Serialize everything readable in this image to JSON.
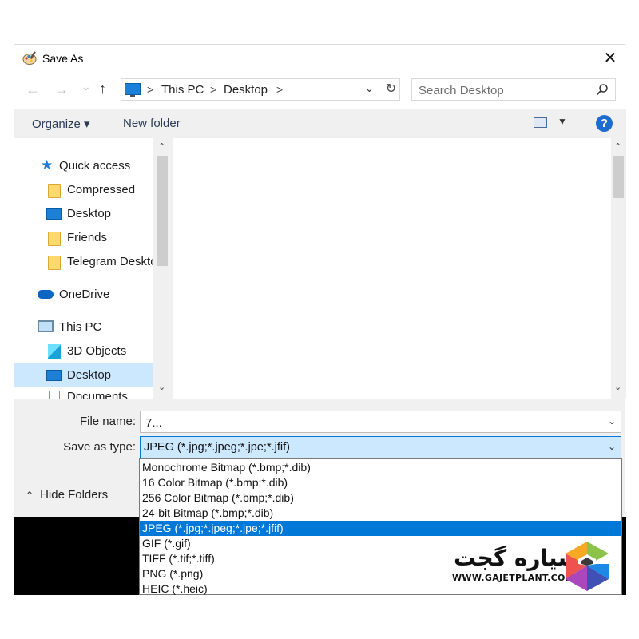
{
  "window": {
    "title": "Save As",
    "close_glyph": "✕"
  },
  "navbar": {
    "back_glyph": "←",
    "forward_glyph": "→",
    "recent_glyph": "⌄",
    "up_glyph": "↑",
    "breadcrumb": [
      "This PC",
      "Desktop"
    ],
    "separator": ">",
    "dropdown_glyph": "⌄",
    "refresh_glyph": "↻",
    "search_placeholder": "Search Desktop"
  },
  "toolbar": {
    "organize": "Organize ▾",
    "new_folder": "New folder",
    "view_dropdown": "▼",
    "help": "?"
  },
  "sidebar": {
    "items": [
      {
        "label": "Quick access",
        "icon": "star-icon"
      },
      {
        "label": "Compressed",
        "icon": "folder-icon"
      },
      {
        "label": "Desktop",
        "icon": "desktop-icon"
      },
      {
        "label": "Friends",
        "icon": "folder-icon"
      },
      {
        "label": "Telegram Desktop",
        "icon": "folder-icon"
      },
      {
        "label": "OneDrive",
        "icon": "cloud-icon"
      },
      {
        "label": "This PC",
        "icon": "computer-icon"
      },
      {
        "label": "3D Objects",
        "icon": "cube-icon"
      },
      {
        "label": "Desktop",
        "icon": "desktop-icon",
        "selected": true
      },
      {
        "label": "Documents",
        "icon": "document-icon"
      }
    ]
  },
  "scroll": {
    "up_glyph": "⌃",
    "down_glyph": "⌄"
  },
  "form": {
    "file_name_label": "File name:",
    "file_name_value": "7...",
    "save_type_label": "Save as type:",
    "save_type_value": "JPEG (*.jpg;*.jpeg;*.jpe;*.jfif)",
    "dropdown_glyph": "⌄"
  },
  "hide_folders": {
    "label": "Hide Folders",
    "glyph": "⌃"
  },
  "type_options": [
    "Monochrome Bitmap (*.bmp;*.dib)",
    "16 Color Bitmap (*.bmp;*.dib)",
    "256 Color Bitmap (*.bmp;*.dib)",
    "24-bit Bitmap (*.bmp;*.dib)",
    "JPEG (*.jpg;*.jpeg;*.jpe;*.jfif)",
    "GIF (*.gif)",
    "TIFF (*.tif;*.tiff)",
    "PNG (*.png)",
    "HEIC (*.heic)"
  ],
  "selected_type_index": 4,
  "watermark": {
    "name": "سیاره گجت",
    "url": "WWW.GAJETPLANT.COM"
  },
  "colors": {
    "accent": "#0078d7",
    "selection": "#cce8ff",
    "help": "#1f6cd1"
  }
}
